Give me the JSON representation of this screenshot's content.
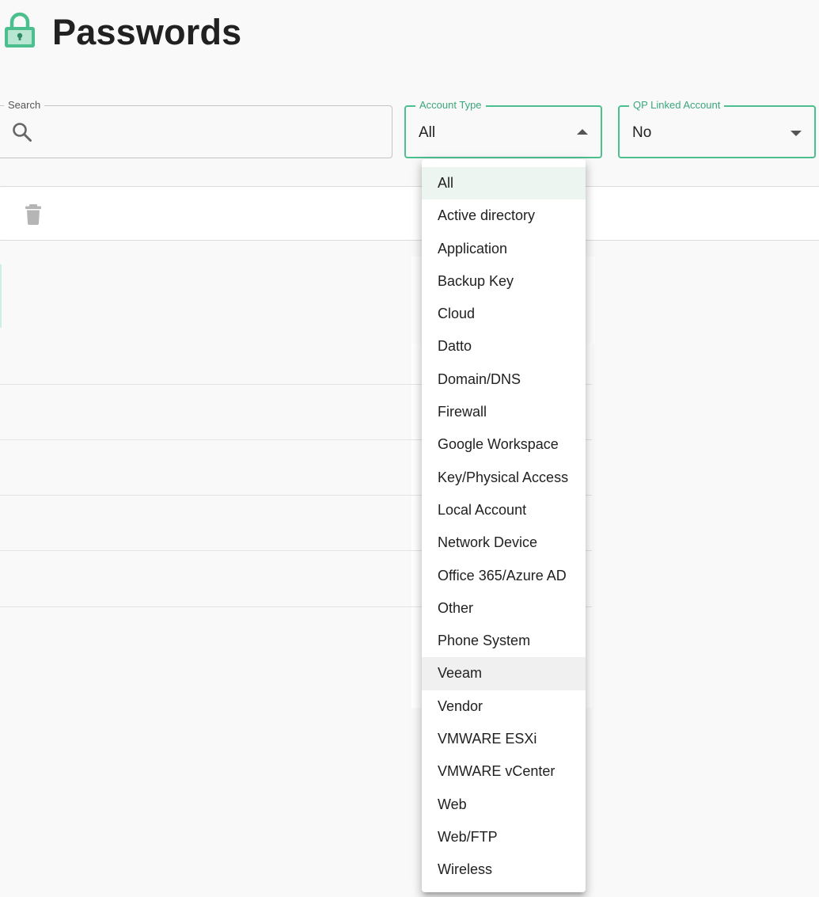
{
  "header": {
    "title": "Passwords",
    "icon": "lock-icon",
    "accent": "#4cbf8f"
  },
  "filters": {
    "search": {
      "label": "Search",
      "value": "",
      "placeholder": ""
    },
    "account_type": {
      "label": "Account Type",
      "value": "All"
    },
    "qp_linked": {
      "label": "QP Linked Account",
      "value": "No"
    }
  },
  "toolbar": {
    "delete_icon": "trash-icon"
  },
  "dropdown": {
    "selected": "All",
    "hovered": "Veeam",
    "options": [
      "All",
      "Active directory",
      "Application",
      "Backup Key",
      "Cloud",
      "Datto",
      "Domain/DNS",
      "Firewall",
      "Google Workspace",
      "Key/Physical Access",
      "Local Account",
      "Network Device",
      "Office 365/Azure AD",
      "Other",
      "Phone System",
      "Veeam",
      "Vendor",
      "VMWARE ESXi",
      "VMWARE vCenter",
      "Web",
      "Web/FTP",
      "Wireless"
    ]
  }
}
